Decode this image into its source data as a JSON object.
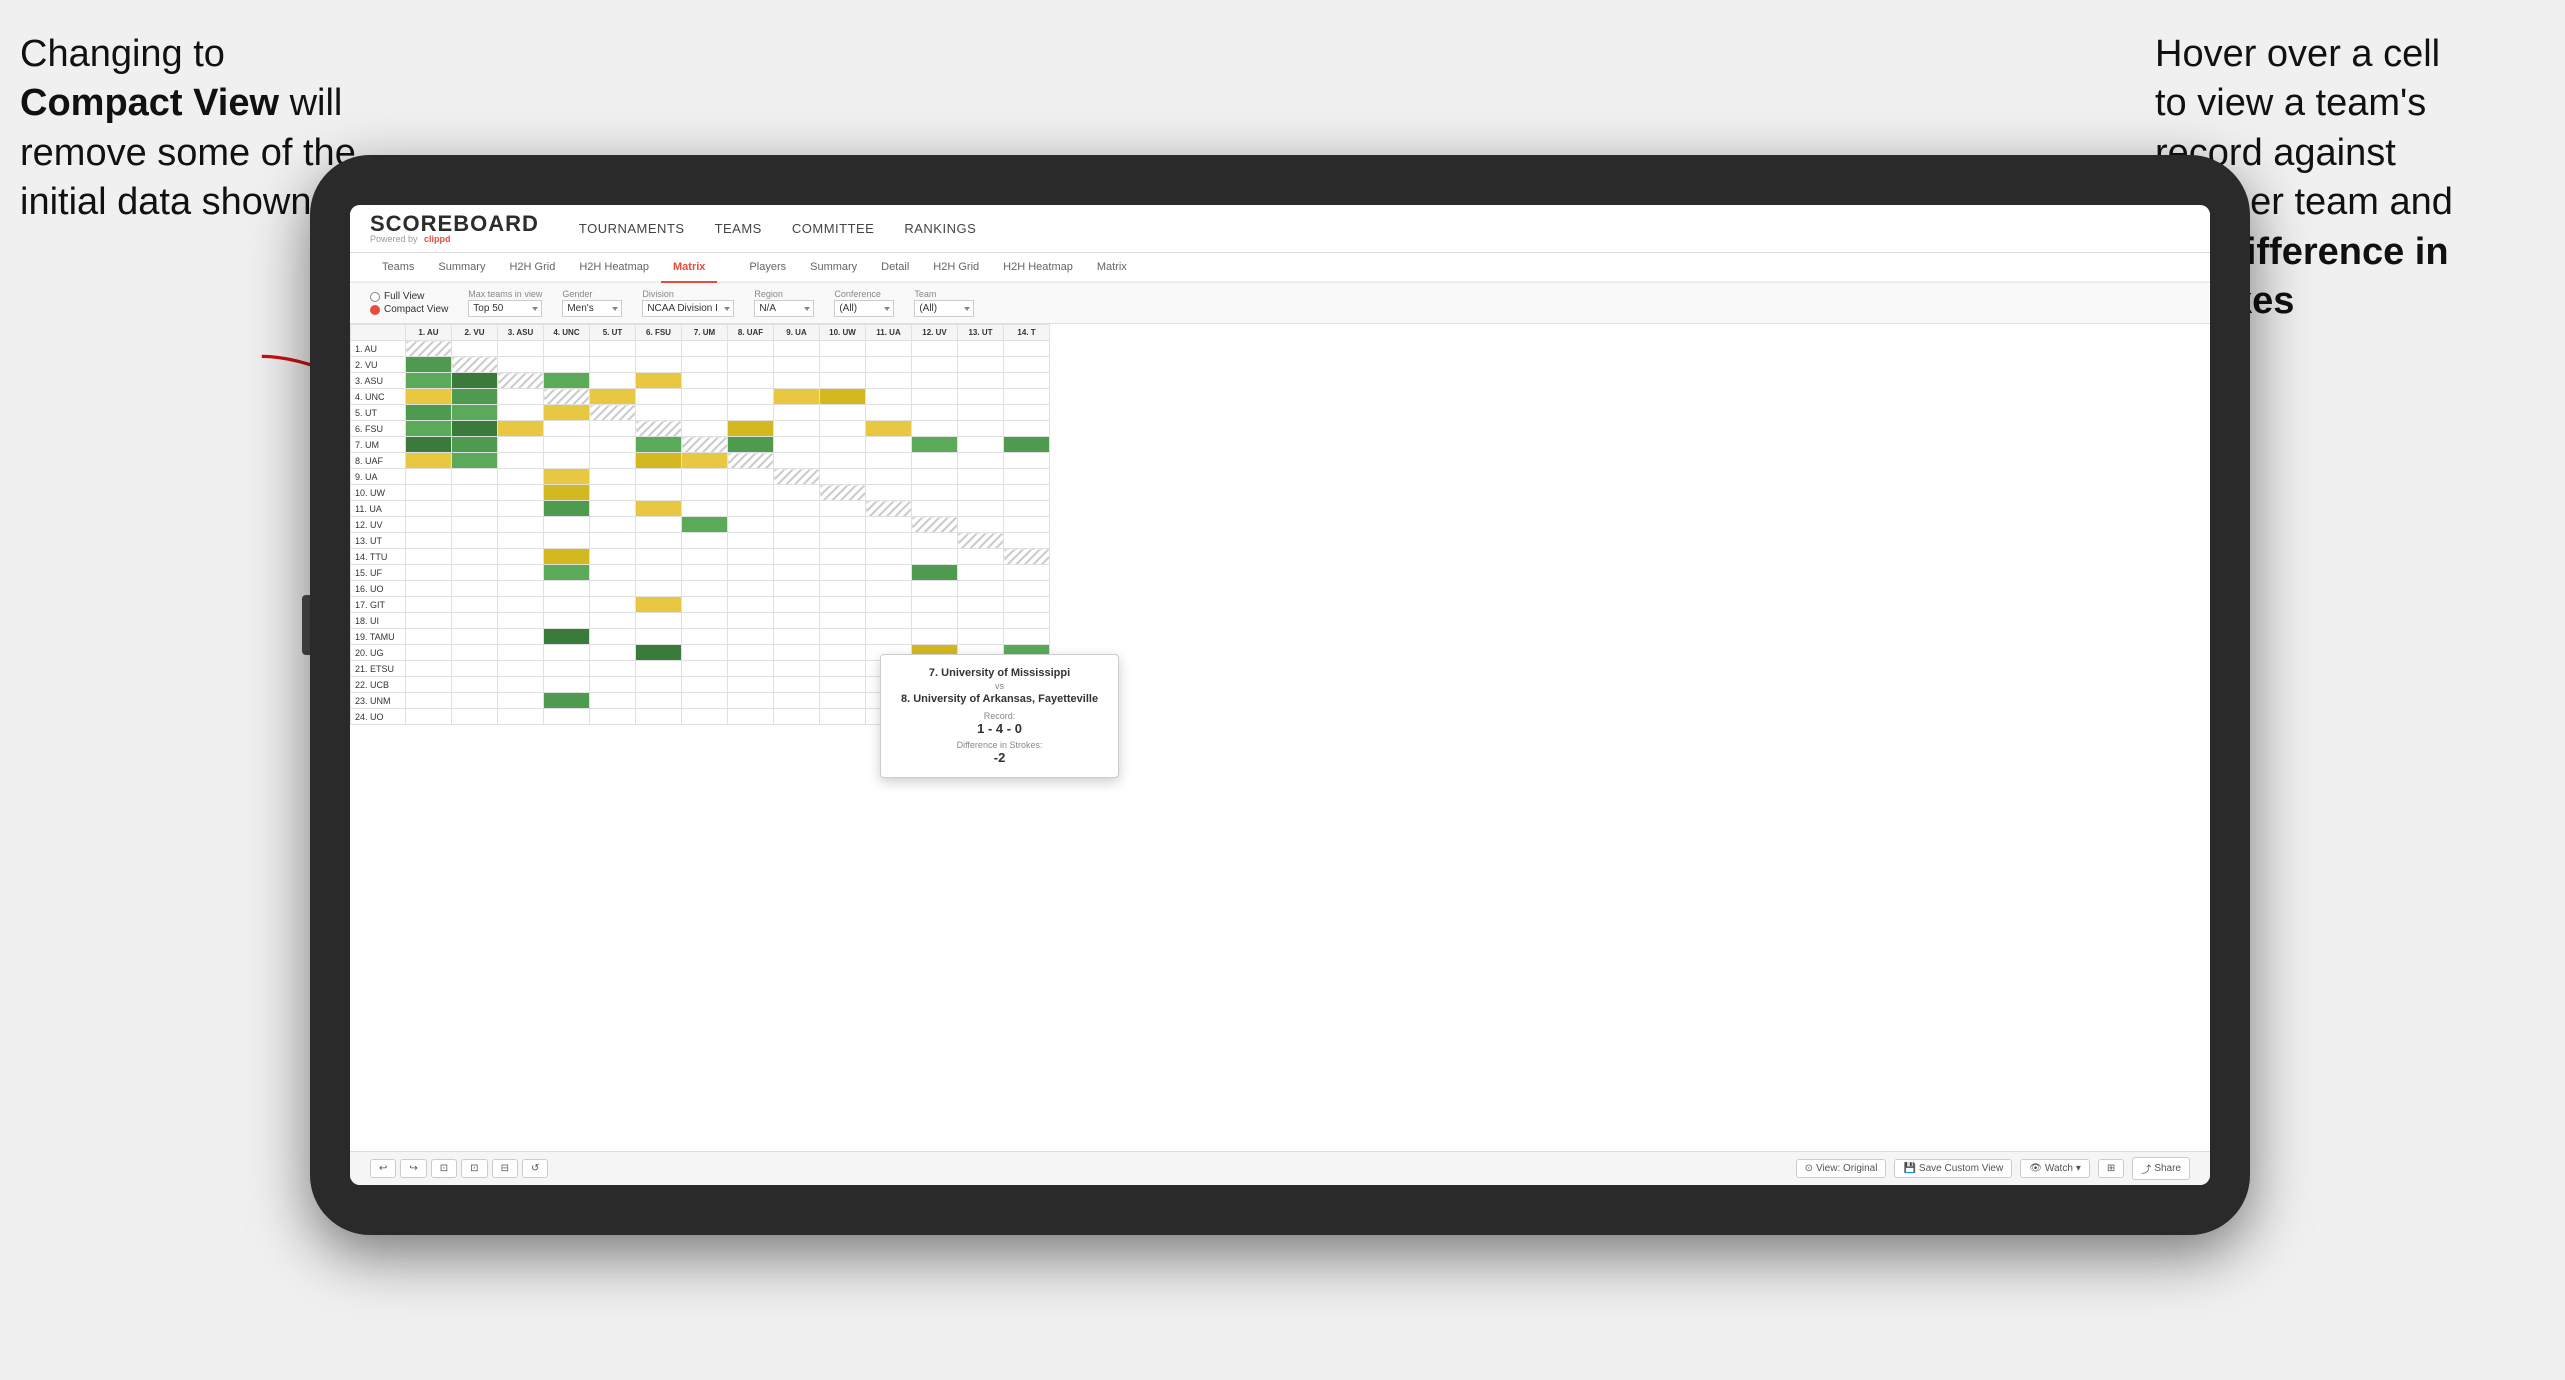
{
  "annotations": {
    "left_text_line1": "Changing to",
    "left_text_bold": "Compact View",
    "left_text_rest": " will remove some of the initial data shown",
    "right_text_line1": "Hover over a cell to view a team's record against another team and the ",
    "right_text_bold": "Difference in Strokes"
  },
  "nav": {
    "logo_main": "SCOREBOARD",
    "logo_sub": "Powered by",
    "logo_brand": "clippd",
    "items": [
      "TOURNAMENTS",
      "TEAMS",
      "COMMITTEE",
      "RANKINGS"
    ]
  },
  "sub_nav": {
    "group1": [
      "Teams",
      "Summary",
      "H2H Grid",
      "H2H Heatmap",
      "Matrix"
    ],
    "group2": [
      "Players",
      "Summary",
      "Detail",
      "H2H Grid",
      "H2H Heatmap",
      "Matrix"
    ],
    "active": "Matrix"
  },
  "controls": {
    "view_full": "Full View",
    "view_compact": "Compact View",
    "compact_selected": true,
    "filters": [
      {
        "label": "Max teams in view",
        "value": "Top 50"
      },
      {
        "label": "Gender",
        "value": "Men's"
      },
      {
        "label": "Division",
        "value": "NCAA Division I"
      },
      {
        "label": "Region",
        "value": "N/A"
      },
      {
        "label": "Conference",
        "value": "(All)"
      },
      {
        "label": "Team",
        "value": "(All)"
      }
    ]
  },
  "matrix": {
    "col_headers": [
      "1. AU",
      "2. VU",
      "3. ASU",
      "4. UNC",
      "5. UT",
      "6. FSU",
      "7. UM",
      "8. UAF",
      "9. UA",
      "10. UW",
      "11. UA",
      "12. UV",
      "13. UT",
      "14. T"
    ],
    "rows": [
      {
        "name": "1. AU",
        "cells": [
          "diag",
          "white",
          "white",
          "white",
          "white",
          "white",
          "white",
          "white",
          "white",
          "white",
          "white",
          "white",
          "white",
          "white"
        ]
      },
      {
        "name": "2. VU",
        "cells": [
          "green",
          "diag",
          "white",
          "white",
          "white",
          "white",
          "white",
          "white",
          "white",
          "white",
          "white",
          "white",
          "white",
          "white"
        ]
      },
      {
        "name": "3. ASU",
        "cells": [
          "green",
          "green",
          "diag",
          "green",
          "white",
          "yellow",
          "white",
          "white",
          "white",
          "white",
          "white",
          "white",
          "white",
          "white"
        ]
      },
      {
        "name": "4. UNC",
        "cells": [
          "yellow",
          "green",
          "white",
          "diag",
          "yellow",
          "white",
          "white",
          "white",
          "yellow",
          "yellow",
          "white",
          "white",
          "white",
          "white"
        ]
      },
      {
        "name": "5. UT",
        "cells": [
          "green",
          "green",
          "white",
          "yellow",
          "diag",
          "white",
          "white",
          "white",
          "white",
          "white",
          "white",
          "white",
          "white",
          "white"
        ]
      },
      {
        "name": "6. FSU",
        "cells": [
          "green",
          "green",
          "yellow",
          "white",
          "white",
          "diag",
          "white",
          "yellow",
          "white",
          "white",
          "yellow",
          "white",
          "white",
          "white"
        ]
      },
      {
        "name": "7. UM",
        "cells": [
          "green",
          "green",
          "white",
          "white",
          "white",
          "green",
          "diag",
          "green",
          "white",
          "white",
          "white",
          "green",
          "white",
          "green"
        ]
      },
      {
        "name": "8. UAF",
        "cells": [
          "yellow",
          "green",
          "white",
          "white",
          "white",
          "yellow",
          "yellow",
          "diag",
          "white",
          "white",
          "white",
          "white",
          "white",
          "white"
        ]
      },
      {
        "name": "9. UA",
        "cells": [
          "white",
          "white",
          "white",
          "yellow",
          "white",
          "white",
          "white",
          "white",
          "diag",
          "white",
          "white",
          "white",
          "white",
          "white"
        ]
      },
      {
        "name": "10. UW",
        "cells": [
          "white",
          "white",
          "white",
          "yellow",
          "white",
          "white",
          "white",
          "white",
          "white",
          "diag",
          "white",
          "white",
          "white",
          "white"
        ]
      },
      {
        "name": "11. UA",
        "cells": [
          "white",
          "white",
          "white",
          "green",
          "white",
          "yellow",
          "white",
          "white",
          "white",
          "white",
          "diag",
          "white",
          "white",
          "white"
        ]
      },
      {
        "name": "12. UV",
        "cells": [
          "white",
          "white",
          "white",
          "white",
          "white",
          "white",
          "green",
          "white",
          "white",
          "white",
          "white",
          "diag",
          "white",
          "white"
        ]
      },
      {
        "name": "13. UT",
        "cells": [
          "white",
          "white",
          "white",
          "white",
          "white",
          "white",
          "white",
          "white",
          "white",
          "white",
          "white",
          "white",
          "diag",
          "white"
        ]
      },
      {
        "name": "14. TTU",
        "cells": [
          "white",
          "white",
          "white",
          "yellow",
          "white",
          "white",
          "white",
          "white",
          "white",
          "white",
          "white",
          "white",
          "white",
          "diag"
        ]
      },
      {
        "name": "15. UF",
        "cells": [
          "white",
          "white",
          "white",
          "green",
          "white",
          "white",
          "white",
          "white",
          "white",
          "white",
          "white",
          "green",
          "white",
          "white"
        ]
      },
      {
        "name": "16. UO",
        "cells": [
          "white",
          "white",
          "white",
          "white",
          "white",
          "white",
          "white",
          "white",
          "white",
          "white",
          "white",
          "white",
          "white",
          "white"
        ]
      },
      {
        "name": "17. GIT",
        "cells": [
          "white",
          "white",
          "white",
          "white",
          "white",
          "yellow",
          "white",
          "white",
          "white",
          "white",
          "white",
          "white",
          "white",
          "white"
        ]
      },
      {
        "name": "18. UI",
        "cells": [
          "white",
          "white",
          "white",
          "white",
          "white",
          "white",
          "white",
          "white",
          "white",
          "white",
          "white",
          "white",
          "white",
          "white"
        ]
      },
      {
        "name": "19. TAMU",
        "cells": [
          "white",
          "white",
          "white",
          "green",
          "white",
          "white",
          "white",
          "white",
          "white",
          "white",
          "white",
          "white",
          "white",
          "white"
        ]
      },
      {
        "name": "20. UG",
        "cells": [
          "white",
          "white",
          "white",
          "white",
          "white",
          "green",
          "white",
          "white",
          "white",
          "white",
          "white",
          "yellow",
          "white",
          "green"
        ]
      },
      {
        "name": "21. ETSU",
        "cells": [
          "white",
          "white",
          "white",
          "white",
          "white",
          "white",
          "white",
          "white",
          "white",
          "white",
          "white",
          "white",
          "white",
          "white"
        ]
      },
      {
        "name": "22. UCB",
        "cells": [
          "white",
          "white",
          "white",
          "white",
          "white",
          "white",
          "white",
          "white",
          "white",
          "white",
          "white",
          "white",
          "white",
          "white"
        ]
      },
      {
        "name": "23. UNM",
        "cells": [
          "white",
          "white",
          "white",
          "green",
          "white",
          "white",
          "white",
          "white",
          "white",
          "white",
          "white",
          "white",
          "white",
          "white"
        ]
      },
      {
        "name": "24. UO",
        "cells": [
          "white",
          "white",
          "white",
          "white",
          "white",
          "white",
          "white",
          "white",
          "white",
          "white",
          "white",
          "green",
          "white",
          "white"
        ]
      }
    ]
  },
  "tooltip": {
    "team1": "7. University of Mississippi",
    "vs": "vs",
    "team2": "8. University of Arkansas, Fayetteville",
    "record_label": "Record:",
    "record_value": "1 - 4 - 0",
    "strokes_label": "Difference in Strokes:",
    "strokes_value": "-2"
  },
  "toolbar": {
    "undo": "↩",
    "redo": "↪",
    "btn1": "⬛",
    "btn2": "⬛",
    "btn3": "⬛",
    "btn4": "↺",
    "view_original": "View: Original",
    "save_custom": "Save Custom View",
    "watch": "Watch",
    "share": "Share"
  }
}
